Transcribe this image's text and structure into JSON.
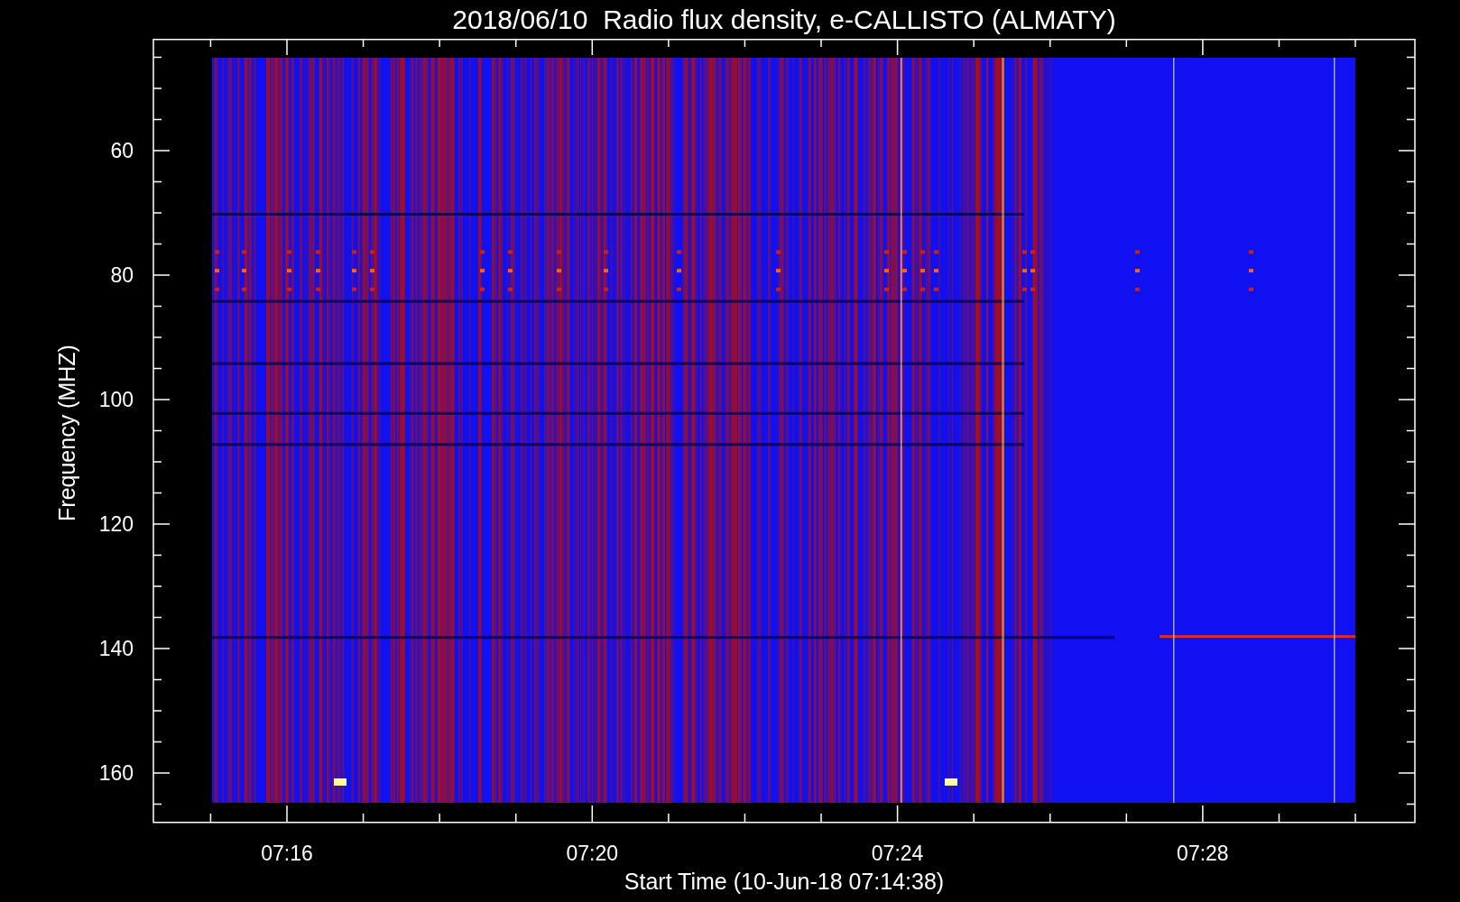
{
  "title": "2018/06/10  Radio flux density, e-CALLISTO (ALMATY)",
  "y_axis": {
    "label": "Frequency (MHZ)",
    "ticks": [
      "60",
      "80",
      "100",
      "120",
      "140",
      "160"
    ]
  },
  "x_axis": {
    "label": "Start Time (10-Jun-18 07:14:38)",
    "ticks": [
      "07:16",
      "07:20",
      "07:24",
      "07:28"
    ]
  }
}
